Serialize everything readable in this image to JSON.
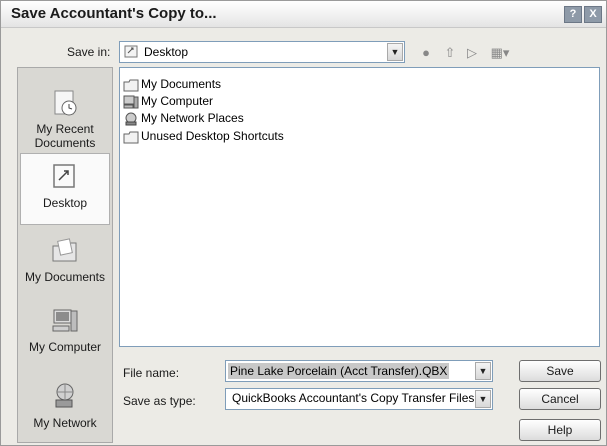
{
  "window": {
    "title": "Save Accountant's Copy to..."
  },
  "title_buttons": {
    "help": "?",
    "close": "X"
  },
  "save_in": {
    "label": "Save in:",
    "value": "Desktop"
  },
  "places": [
    {
      "label_line1": "My Recent",
      "label_line2": "Documents"
    },
    {
      "label_line1": "Desktop",
      "label_line2": ""
    },
    {
      "label_line1": "My Documents",
      "label_line2": ""
    },
    {
      "label_line1": "My Computer",
      "label_line2": ""
    },
    {
      "label_line1": "My Network",
      "label_line2": ""
    }
  ],
  "files": [
    "My Documents",
    "My Computer",
    "My Network Places",
    "Unused Desktop Shortcuts"
  ],
  "file_name": {
    "label": "File name:",
    "value": "Pine Lake Porcelain (Acct Transfer).QBX"
  },
  "save_as_type": {
    "label": "Save as type:",
    "value": "QuickBooks Accountant's Copy Transfer Files ("
  },
  "buttons": {
    "save": "Save",
    "cancel": "Cancel",
    "help": "Help"
  }
}
